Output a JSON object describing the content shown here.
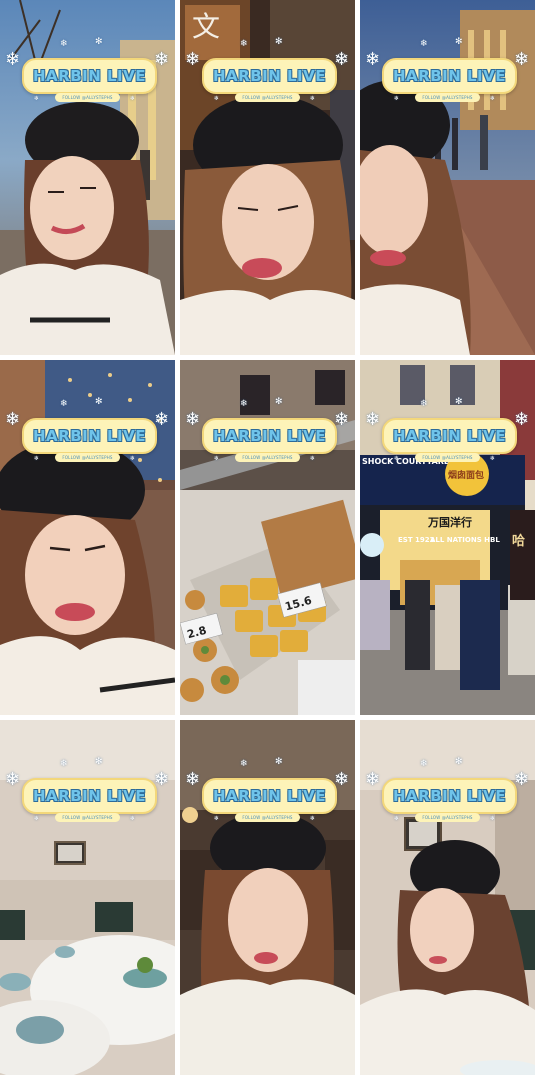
{
  "overlay": {
    "title": "HARBIN LIVE",
    "follow_text": "FOLLOW @ALLYSTEPHS"
  },
  "signs": {
    "store_name_cn": "万国洋行",
    "store_name_en": "ALL NATIONS HBL",
    "store_year": "EST 1922",
    "shop_left": "SHOCK COURTYARD",
    "bakery_badge": "烟囱面包",
    "shop_cn_vertical": "哈",
    "street_sign_top": "文",
    "price_left": "2.8",
    "price_right": "15.6"
  },
  "panels": [
    {
      "id": "street-night-1"
    },
    {
      "id": "street-night-2"
    },
    {
      "id": "street-night-3"
    },
    {
      "id": "tree-lights"
    },
    {
      "id": "food-counter"
    },
    {
      "id": "storefront"
    },
    {
      "id": "restaurant-table"
    },
    {
      "id": "restaurant-portrait"
    },
    {
      "id": "restaurant-corner"
    }
  ]
}
